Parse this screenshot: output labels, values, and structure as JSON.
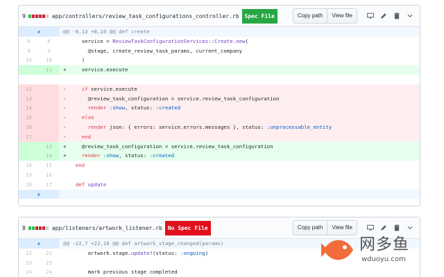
{
  "files": [
    {
      "count": "9",
      "blocks": [
        "g",
        "r",
        "r",
        "r",
        "r",
        "n"
      ],
      "path": "app/controllers/review_task_configurations_controller.rb",
      "badge": "Spec File",
      "badge_color": "#28a745",
      "copy_path": "Copy path",
      "view_file": "View file",
      "rows": [
        {
          "type": "hunk",
          "old": "",
          "new": "",
          "code": "@@ -8,13 +8,10 @@ def create"
        },
        {
          "type": "ctx",
          "old": "8",
          "new": "8",
          "code": "      service = ReviewTaskConfigurationServices::Create.new("
        },
        {
          "type": "ctx",
          "old": "9",
          "new": "9",
          "code": "        @stage, create_review_task_params, current_company"
        },
        {
          "type": "ctx",
          "old": "10",
          "new": "10",
          "code": "      )"
        },
        {
          "type": "add",
          "old": "",
          "new": "11",
          "code": "+     service.execute"
        },
        {
          "type": "ctx",
          "old": "",
          "new": "",
          "code": ""
        },
        {
          "type": "del",
          "old": "12",
          "new": "",
          "code": "-     if service.execute"
        },
        {
          "type": "del",
          "old": "13",
          "new": "",
          "code": "-       @review_task_configuration = service.review_task_configuration"
        },
        {
          "type": "del",
          "old": "14",
          "new": "",
          "code": "-       render :show, status: :created"
        },
        {
          "type": "del",
          "old": "15",
          "new": "",
          "code": "-     else"
        },
        {
          "type": "del",
          "old": "16",
          "new": "",
          "code": "-       render json: { errors: service.errors.messages }, status: :unprocessable_entity"
        },
        {
          "type": "del",
          "old": "17",
          "new": "",
          "code": "-     end"
        },
        {
          "type": "add",
          "old": "",
          "new": "13",
          "code": "+     @review_task_configuration = service.review_task_configuration"
        },
        {
          "type": "add",
          "old": "",
          "new": "14",
          "code": "+     render :show, status: :created"
        },
        {
          "type": "ctx",
          "old": "18",
          "new": "15",
          "code": "    end"
        },
        {
          "type": "ctx",
          "old": "19",
          "new": "16",
          "code": ""
        },
        {
          "type": "ctx",
          "old": "20",
          "new": "17",
          "code": "    def update"
        },
        {
          "type": "hunk",
          "old": "",
          "new": "",
          "code": ""
        }
      ]
    },
    {
      "count": "8",
      "blocks": [
        "g",
        "g",
        "r",
        "r",
        "r",
        "n"
      ],
      "path": "app/listeners/artwork_listener.rb",
      "badge": "No Spec File",
      "badge_color": "#e0101c",
      "copy_path": "Copy path",
      "view_file": "View file",
      "rows": [
        {
          "type": "hunk",
          "old": "",
          "new": "",
          "code": "@@ -22,7 +22,10 @@ def artwork_stage_changed(params)"
        },
        {
          "type": "ctx",
          "old": "22",
          "new": "22",
          "code": "        artwork.stage.update!(status: :ongoing)"
        },
        {
          "type": "ctx",
          "old": "23",
          "new": "23",
          "code": ""
        },
        {
          "type": "ctx",
          "old": "24",
          "new": "24",
          "code": "        mark previous stage completed"
        }
      ]
    }
  ],
  "watermark": {
    "text": "网多鱼",
    "url": "wduoyu.com"
  },
  "icons": {
    "desktop": "desktop-icon",
    "edit": "pencil-icon",
    "delete": "trash-icon",
    "collapse": "chevron-down-icon",
    "expand": "expand-icon"
  }
}
